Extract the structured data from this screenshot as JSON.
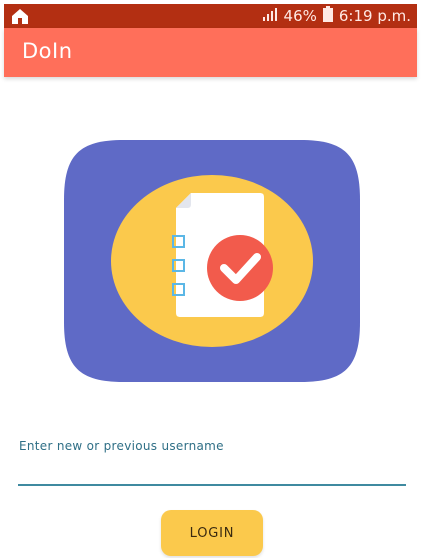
{
  "status_bar": {
    "left_icon": "home-icon",
    "signal_icon": "signal-icon",
    "battery_percent": "46%",
    "battery_icon": "battery-icon",
    "time": "6:19 p.m."
  },
  "app_bar": {
    "title": "DoIn"
  },
  "logo": {
    "icon": "checklist-clipboard-icon",
    "colors": {
      "background": "#5f6ac6",
      "circle": "#fbc94c",
      "paper": "#ffffff",
      "checkbox": "#5bb7e6",
      "check_badge": "#f25b4c"
    }
  },
  "login_form": {
    "username_label": "Enter new or previous username",
    "username_value": "",
    "login_label": "LOGIN"
  },
  "colors": {
    "status_bar": "#b32f12",
    "app_bar": "#ff6f5a",
    "input_underline": "#3f8aa0",
    "button": "#fbc94c"
  }
}
